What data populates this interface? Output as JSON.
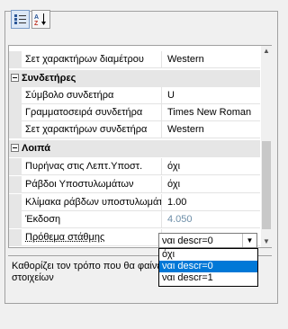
{
  "toolbar": {
    "categorized_icon": "categorized-icon",
    "alphabetical_icon": "alphabetical-az-icon"
  },
  "grid": {
    "top_row": {
      "name": "Σετ χαρακτήρων διαμέτρου",
      "value": "Western"
    },
    "categories": [
      {
        "label": "Συνδετήρες",
        "rows": [
          {
            "name": "Σύμβολο συνδετήρα",
            "value": "U"
          },
          {
            "name": "Γραμματοσειρά συνδετήρα",
            "value": "Times New Roman"
          },
          {
            "name": "Σετ χαρακτήρων συνδετήρα",
            "value": "Western"
          }
        ]
      },
      {
        "label": "Λοιπά",
        "rows": [
          {
            "name": "Πυρήνας στις Λεπτ.Υποστ.",
            "value": "όχι"
          },
          {
            "name": "Ράβδοι Υποστυλωμάτων",
            "value": "όχι"
          },
          {
            "name": "Κλίμακα ράβδων υποστυλωμάτ",
            "value": "1.00"
          },
          {
            "name": "Έκδοση",
            "value": "4.050"
          },
          {
            "name": "Πρόθεμα στάθμης",
            "value": "ναι descr=0"
          }
        ]
      }
    ]
  },
  "dropdown": {
    "selected": "ναι descr=0",
    "options": [
      "όχι",
      "ναι descr=0",
      "ναι descr=1"
    ]
  },
  "description": "Καθορίζει τον τρόπο που θα φαίνε πινακίδες των στοιχείων"
}
